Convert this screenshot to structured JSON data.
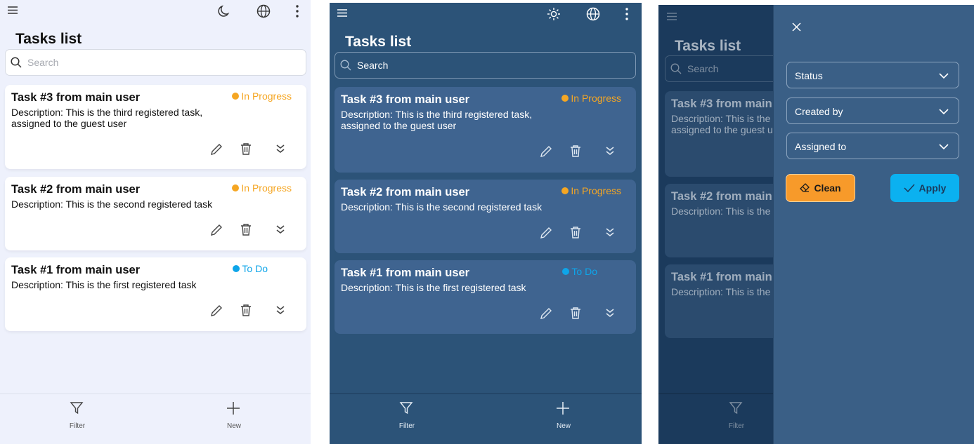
{
  "colors": {
    "in_progress": "#f5a623",
    "to_do": "#0ea5e9",
    "light_bg": "#eef1fc",
    "dark_bg": "#2c5378",
    "clean_btn": "#f79a2a",
    "apply_btn": "#0bb1f0"
  },
  "icons": [
    "menu-icon",
    "moon-icon",
    "sun-icon",
    "globe-icon",
    "more-vertical-icon",
    "search-icon",
    "edit-icon",
    "delete-icon",
    "expand-icon",
    "filter-icon",
    "plus-icon",
    "close-icon",
    "chevron-down-icon",
    "eraser-icon",
    "check-icon"
  ],
  "header": {
    "title": "Tasks list"
  },
  "search": {
    "placeholder": "Search"
  },
  "tasks": [
    {
      "title": "Task #3 from main user",
      "description": "Description: This is the third registered task, assigned to the guest user",
      "status": "In Progress"
    },
    {
      "title": "Task #2 from main user",
      "description": "Description: This is the second registered task",
      "status": "In Progress"
    },
    {
      "title": "Task #1 from main user",
      "description": "Description: This is the first registered task",
      "status": "To Do"
    }
  ],
  "bottom_nav": {
    "filter_label": "Filter",
    "new_label": "New"
  },
  "filter_panel": {
    "fields": [
      {
        "label": "Status"
      },
      {
        "label": "Created by"
      },
      {
        "label": "Assigned to"
      }
    ],
    "clean_label": "Clean",
    "apply_label": "Apply"
  }
}
